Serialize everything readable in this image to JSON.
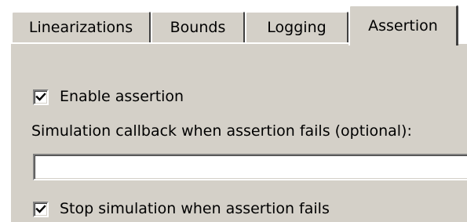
{
  "tabs": [
    {
      "label": "Linearizations"
    },
    {
      "label": "Bounds"
    },
    {
      "label": "Logging"
    },
    {
      "label": "Assertion"
    }
  ],
  "active_tab": "Assertion",
  "assertion": {
    "enable_label": "Enable assertion",
    "enable_checked": true,
    "callback_label": "Simulation callback when assertion fails (optional):",
    "callback_value": "",
    "callback_placeholder": "",
    "stop_label": "Stop simulation when assertion fails",
    "stop_checked": true
  }
}
